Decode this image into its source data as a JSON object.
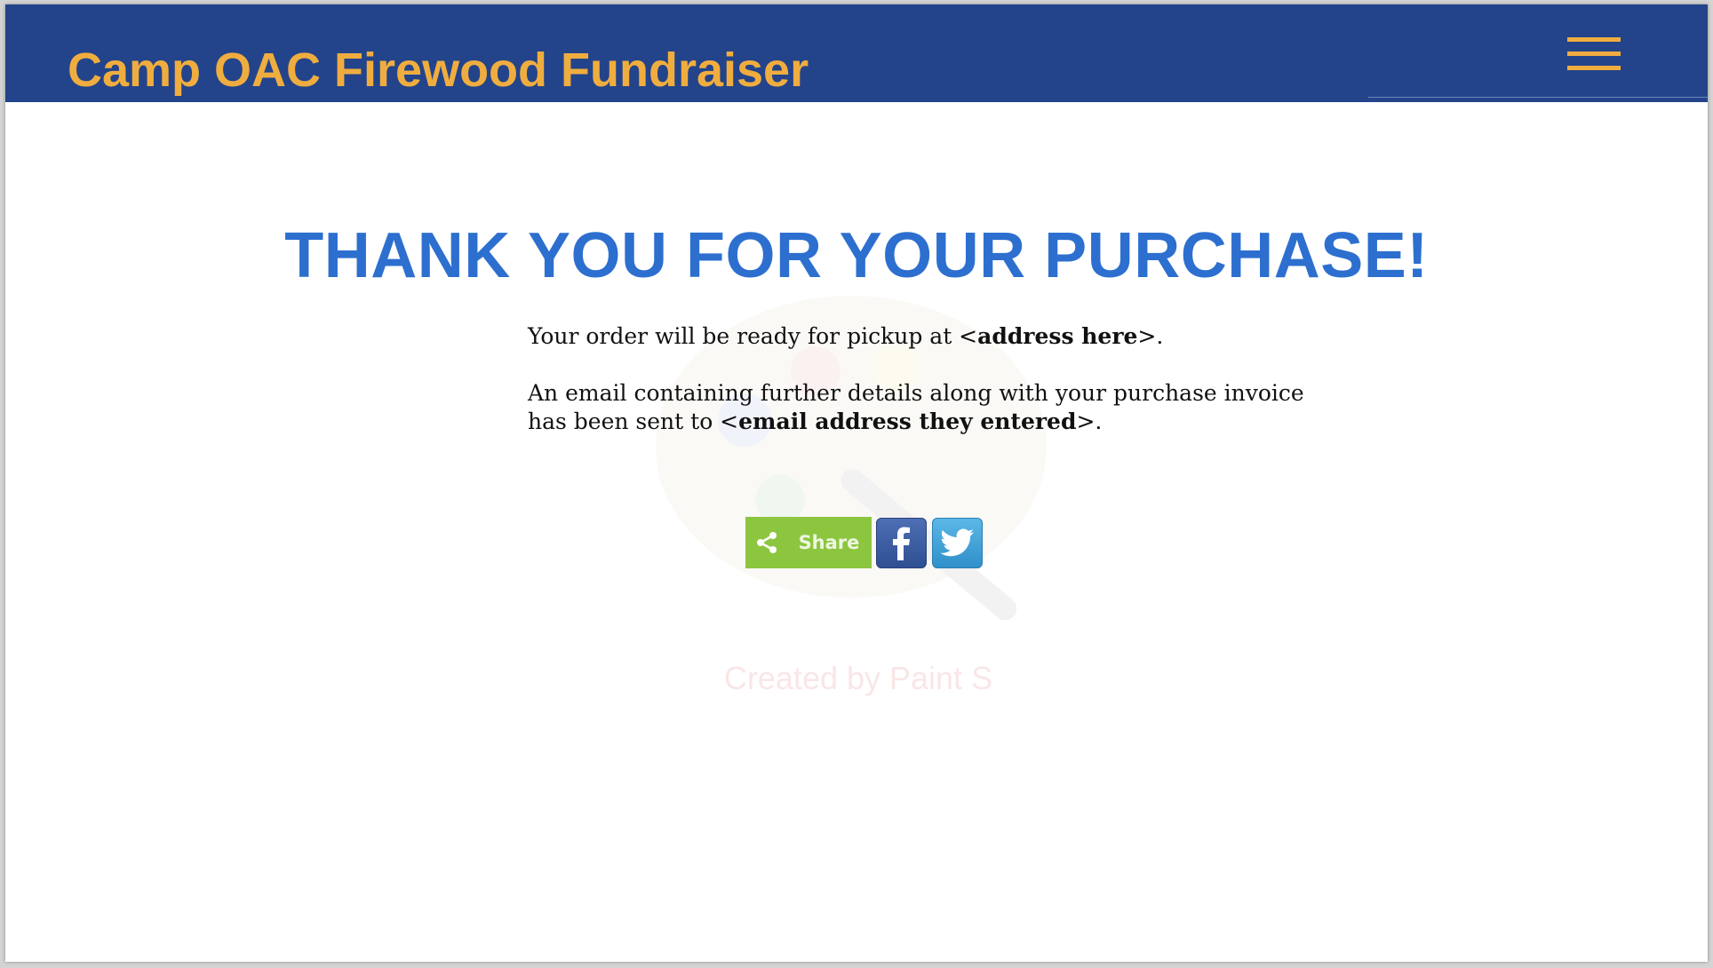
{
  "header": {
    "site_title": "Camp OAC Firewood Fundraiser",
    "menu_icon": "hamburger-menu-icon"
  },
  "main": {
    "heading": "THANK YOU FOR YOUR PURCHASE!",
    "pickup": {
      "prefix": "Your order will be ready for pickup at <",
      "address": "address here",
      "suffix": ">."
    },
    "email": {
      "line1": "An email containing further details along with your purchase invoice",
      "line2_prefix": "has been sent to <",
      "address": "email address they entered",
      "line2_suffix": ">."
    }
  },
  "share": {
    "label": "Share",
    "icons": [
      "share-icon",
      "facebook-icon",
      "twitter-icon"
    ]
  },
  "watermark": {
    "text": "Created by Paint S"
  },
  "colors": {
    "header_bg": "#23448a",
    "title_accent": "#f0ad3f",
    "heading_blue": "#2d6fcf",
    "share_green": "#8cc63f",
    "facebook_blue": "#3b5998",
    "twitter_blue": "#3ea4dc"
  }
}
